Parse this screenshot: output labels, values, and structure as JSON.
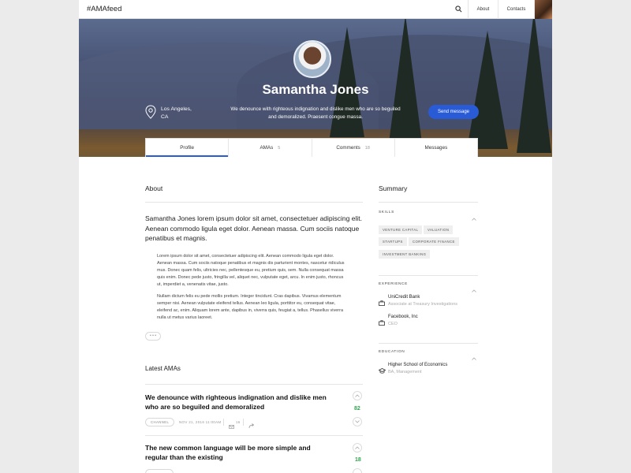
{
  "nav": {
    "brand": "#AMAfeed",
    "about": "About",
    "contacts": "Contacts",
    "icons": {
      "search": "search-icon",
      "avatar": "user-avatar"
    }
  },
  "profile": {
    "name": "Samantha Jones",
    "location_line1": "Los Angeles,",
    "location_line2": "CA",
    "bio": "We denounce with righteous indignation and dislike men who are so beguiled and demoralized. Praesent congue massa.",
    "send_label": "Send message",
    "accent_color": "#2a5bd7"
  },
  "tabs": [
    {
      "label": "Profile",
      "count": ""
    },
    {
      "label": "AMAs",
      "count": "5"
    },
    {
      "label": "Comments",
      "count": "18"
    },
    {
      "label": "Messages",
      "count": ""
    }
  ],
  "about": {
    "heading": "About",
    "lead": "Samantha Jones lorem ipsum dolor sit amet, consectetuer adipiscing elit. Aenean commodo ligula eget dolor. Aenean massa. Cum sociis natoque penatibus et magnis.",
    "p1": "Lorem ipsum dolor sit amet, consectetuer adipiscing elit. Aenean commodo ligula eget dolor. Aenean massa. Cum sociis natoque penatibus et magnis dis parturient montes, nascetur ridiculus mus. Donec quam felis, ultricies nec, pellentesque eu, pretium quis, sem. Nulla consequat massa quis enim. Donec pede justo, fringilla vel, aliquet nec, vulputate eget, arcu. In enim justo, rhoncus ut, imperdiet a, venenatis vitae, justo.",
    "p2": "Nullam dictum felis eu pede mollis pretium. Integer tincidunt. Cras dapibus. Vivamus elementum semper nisi. Aenean vulputate eleifend tellus. Aenean leo ligula, porttitor eu, consequat vitae, eleifend ac, enim. Aliquam lorem ante, dapibus in, viverra quis, feugiat a, tellus. Phasellus viverra nulla ut metus varius laoreet.",
    "more_label": "• • •"
  },
  "latest": {
    "heading": "Latest AMAs",
    "items": [
      {
        "title": "We denounce with righteous indignation and dislike men who are so beguiled and demoralized",
        "tag": "CHANNEL",
        "date": "NOV 21, 2016 11:00AM",
        "comments": "16",
        "votes": "82"
      },
      {
        "title": "The new common language will be more simple and regular than the existing",
        "votes": "18"
      }
    ]
  },
  "summary": {
    "heading": "Summary",
    "skills_label": "SKILLS",
    "skills": [
      "VENTURE CAPITAL",
      "VALUATION",
      "STARTUPS",
      "CORPORATE FINANCE",
      "INVESTMENT BANKING"
    ],
    "experience_label": "EXPERIENCE",
    "experience": [
      {
        "name": "UniCredit Bank",
        "role": "Associate at Treasury Investigations"
      },
      {
        "name": "Facebook, Inc",
        "role": "CEO"
      }
    ],
    "education_label": "EDUCATION",
    "education": [
      {
        "name": "Higher School of Economics",
        "degree": "BA, Management"
      }
    ]
  }
}
